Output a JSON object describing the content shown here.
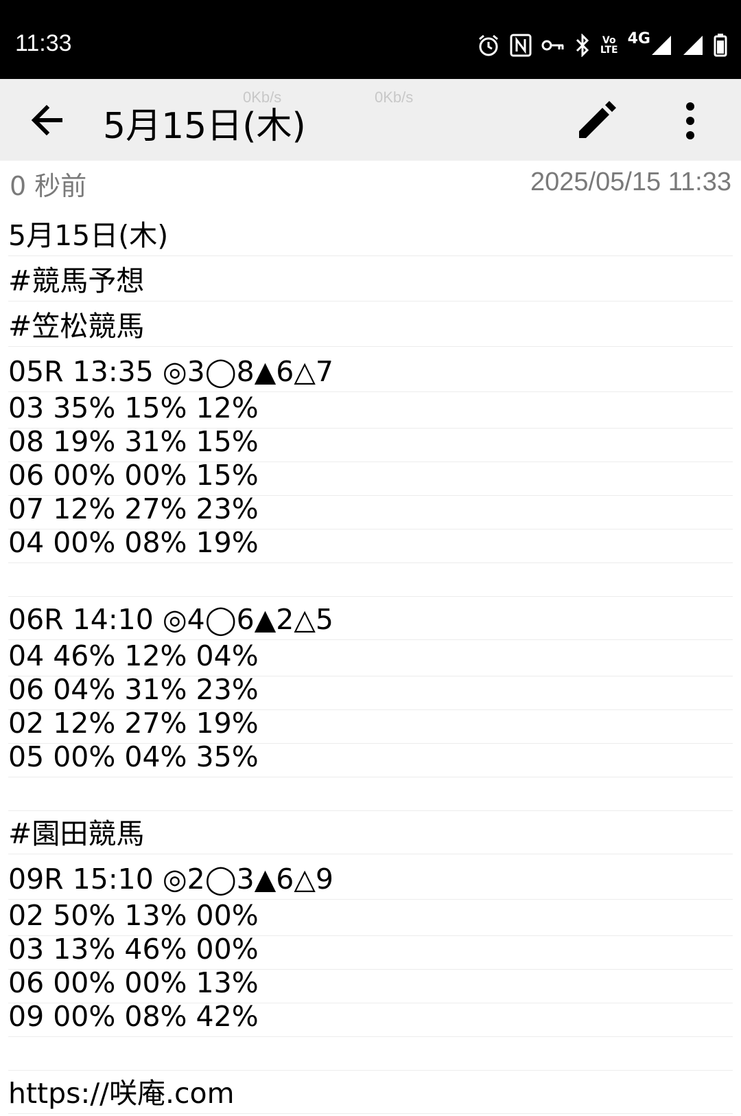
{
  "status_bar": {
    "time": "11:33",
    "icons": [
      "alarm-icon",
      "nfc-icon",
      "vpn-key-icon",
      "bluetooth-icon",
      "volte-icon",
      "4g-signal-icon",
      "signal-icon",
      "battery-icon"
    ],
    "volte_line1": "Vo",
    "volte_line2": "LTE",
    "network": "4G"
  },
  "net_speed": {
    "left": "0Kb/s",
    "right": "0Kb/s"
  },
  "app_bar": {
    "title": "5月15日(木)",
    "icons": [
      "back-arrow-icon",
      "edit-pencil-icon",
      "more-vert-icon"
    ]
  },
  "meta": {
    "relative_time": "0 秒前",
    "timestamp": "2025/05/15 11:33"
  },
  "note_lines": [
    "5月15日(木)",
    "#競馬予想",
    "#笠松競馬",
    "05R 13:35 ◎3◯8▲6△7",
    "03 35% 15% 12%",
    "08 19% 31% 15%",
    "06 00% 00% 15%",
    "07 12% 27% 23%",
    "04 00% 08% 19%",
    "",
    "06R 14:10 ◎4◯6▲2△5",
    "04 46% 12% 04%",
    "06 04% 31% 23%",
    "02 12% 27% 19%",
    "05 00% 04% 35%",
    "",
    "#園田競馬",
    "09R 15:10 ◎2◯3▲6△9",
    "02 50% 13% 00%",
    "03 13% 46% 00%",
    "06 00% 00% 13%",
    "09 00% 08% 42%",
    "",
    "https://咲庵.com"
  ]
}
